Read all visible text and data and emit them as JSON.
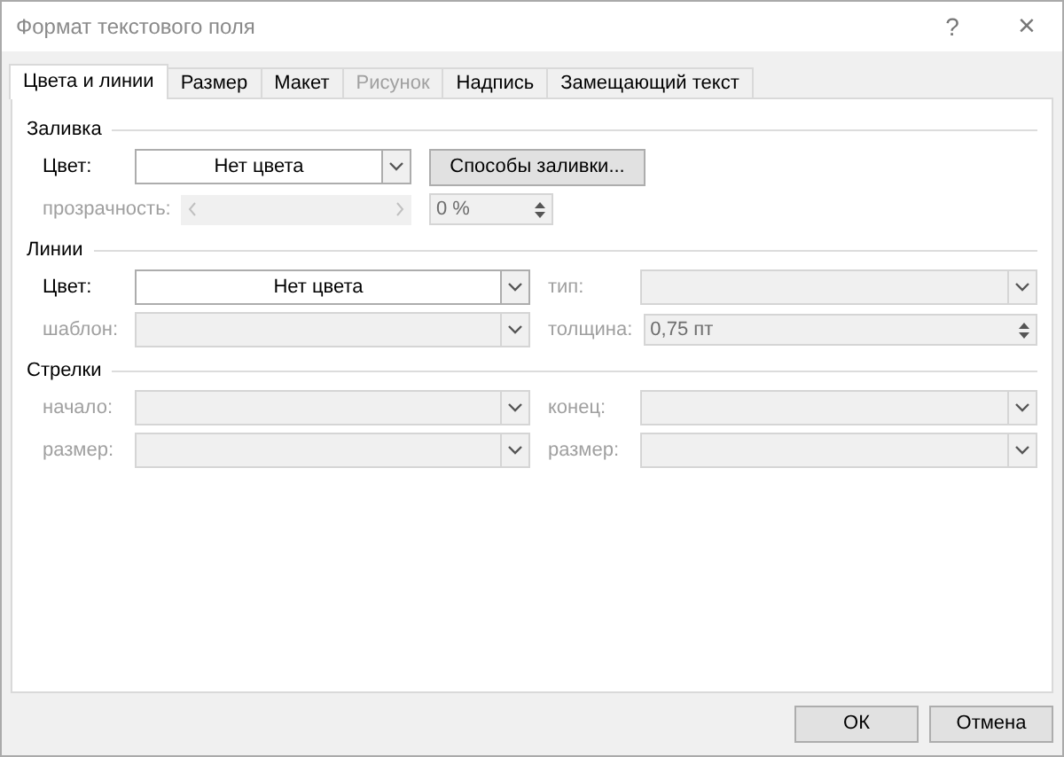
{
  "window": {
    "title": "Формат текстового поля",
    "help": "?",
    "close": "×"
  },
  "tabs": [
    {
      "label": "Цвета и линии",
      "selected": true,
      "disabled": false
    },
    {
      "label": "Размер",
      "selected": false,
      "disabled": false
    },
    {
      "label": "Макет",
      "selected": false,
      "disabled": false
    },
    {
      "label": "Рисунок",
      "selected": false,
      "disabled": true
    },
    {
      "label": "Надпись",
      "selected": false,
      "disabled": false
    },
    {
      "label": "Замещающий текст",
      "selected": false,
      "disabled": false
    }
  ],
  "sections": [
    {
      "title": "Заливка",
      "rows": [
        [
          {
            "label": "Цвет:",
            "kind": "dropdown",
            "value": "Нет цвета",
            "disabled": false
          },
          {
            "kind": "button",
            "value": "Способы заливки...",
            "disabled": false
          }
        ],
        [
          {
            "label": "прозрачность:",
            "kind": "slider",
            "disabled": true
          },
          {
            "kind": "spin",
            "value": "0 %",
            "disabled": true
          }
        ]
      ]
    },
    {
      "title": "Линии",
      "rows": [
        [
          {
            "label": "Цвет:",
            "kind": "dropdown",
            "value": "Нет цвета",
            "disabled": false
          },
          {
            "label": "тип:",
            "kind": "dropdown",
            "disabled": true
          }
        ],
        [
          {
            "label": "шаблон:",
            "kind": "dropdown",
            "disabled": true
          },
          {
            "label": "толщина:",
            "kind": "spin",
            "value": "0,75 пт",
            "disabled": true
          }
        ]
      ]
    },
    {
      "title": "Стрелки",
      "rows": [
        [
          {
            "label": "начало:",
            "kind": "dropdown",
            "disabled": true
          },
          {
            "label": "конец:",
            "kind": "dropdown",
            "disabled": true
          }
        ],
        [
          {
            "label": "размер:",
            "kind": "dropdown",
            "disabled": true
          },
          {
            "label": "размер:",
            "kind": "dropdown",
            "disabled": true
          }
        ]
      ]
    }
  ],
  "buttons": [
    "ОК",
    "Отмена"
  ]
}
